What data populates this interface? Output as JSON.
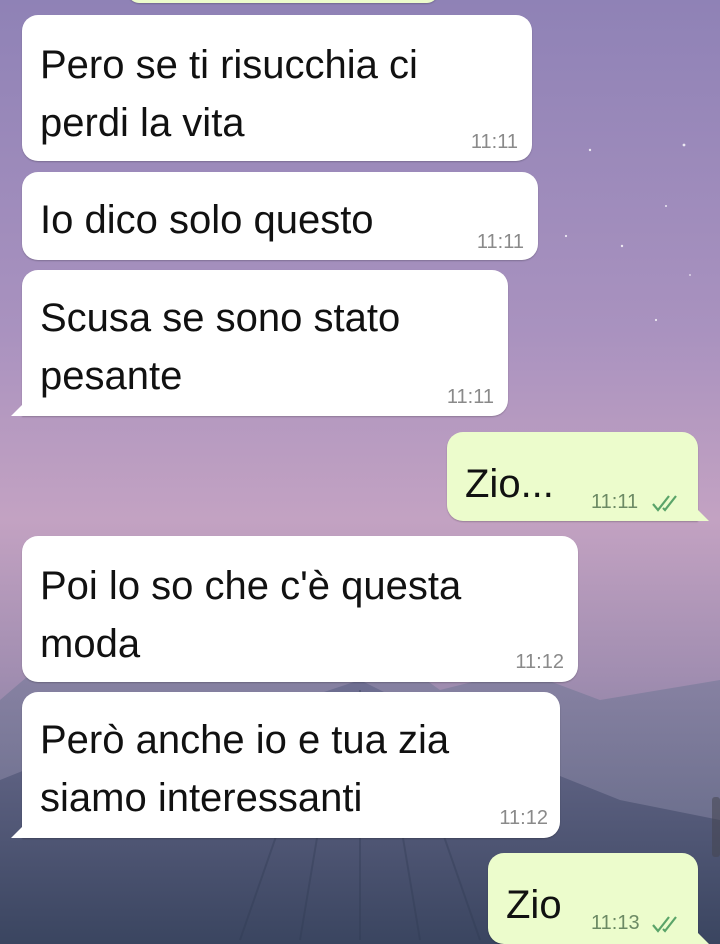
{
  "chat": {
    "messages": [
      {
        "direction": "in",
        "lines": [
          "Pero se ti risucchia ci",
          "perdi la vita"
        ],
        "time": "11:11"
      },
      {
        "direction": "in",
        "lines": [
          "Io dico solo questo"
        ],
        "time": "11:11"
      },
      {
        "direction": "in",
        "lines": [
          "Scusa se sono stato",
          "pesante"
        ],
        "time": "11:11"
      },
      {
        "direction": "out",
        "lines": [
          "Zio..."
        ],
        "time": "11:11",
        "status": "delivered-double-check"
      },
      {
        "direction": "in",
        "lines": [
          "Poi lo so che c'è questa",
          "moda"
        ],
        "time": "11:12"
      },
      {
        "direction": "in",
        "lines": [
          "Però anche io e tua zia",
          "siamo interessanti"
        ],
        "time": "11:12"
      },
      {
        "direction": "out",
        "lines": [
          "Zio"
        ],
        "time": "11:13",
        "status": "delivered-double-check"
      }
    ]
  },
  "colors": {
    "incoming_bubble": "#ffffff",
    "outgoing_bubble": "#ecfccc",
    "wallpaper_top": "#8e7fb3",
    "wallpaper_bottom": "#3a4560"
  },
  "icons": [
    "double-check-icon"
  ]
}
